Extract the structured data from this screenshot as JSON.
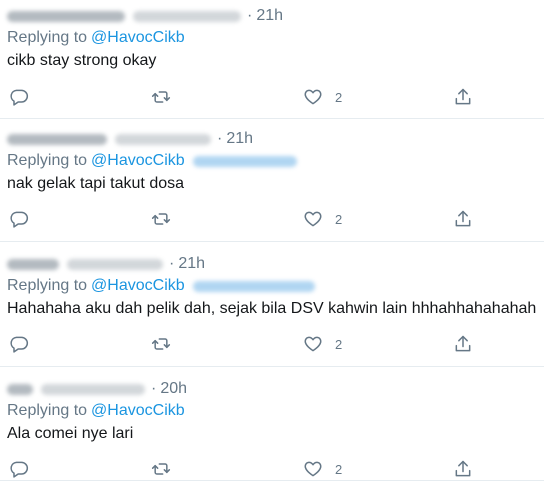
{
  "tweets": [
    {
      "time": "21h",
      "replying_label": "Replying to",
      "mention": "@HavocCikb",
      "text": "cikb stay strong okay",
      "like_count": "2"
    },
    {
      "time": "21h",
      "replying_label": "Replying to",
      "mention": "@HavocCikb",
      "text": "nak gelak tapi takut dosa",
      "like_count": "2"
    },
    {
      "time": "21h",
      "replying_label": "Replying to",
      "mention": "@HavocCikb",
      "text": "Hahahaha aku dah pelik dah, sejak bila DSV kahwin lain hhhahhahahahah",
      "like_count": "2"
    },
    {
      "time": "20h",
      "replying_label": "Replying to",
      "mention": "@HavocCikb",
      "text": "Ala comei nye lari",
      "like_count": "2"
    }
  ],
  "icons": {
    "reply": "reply-icon",
    "retweet": "retweet-icon",
    "like": "heart-icon",
    "share": "share-icon"
  },
  "colors": {
    "text": "#14171a",
    "muted": "#657786",
    "link": "#1b95e0",
    "divider": "#e6ecf0"
  }
}
